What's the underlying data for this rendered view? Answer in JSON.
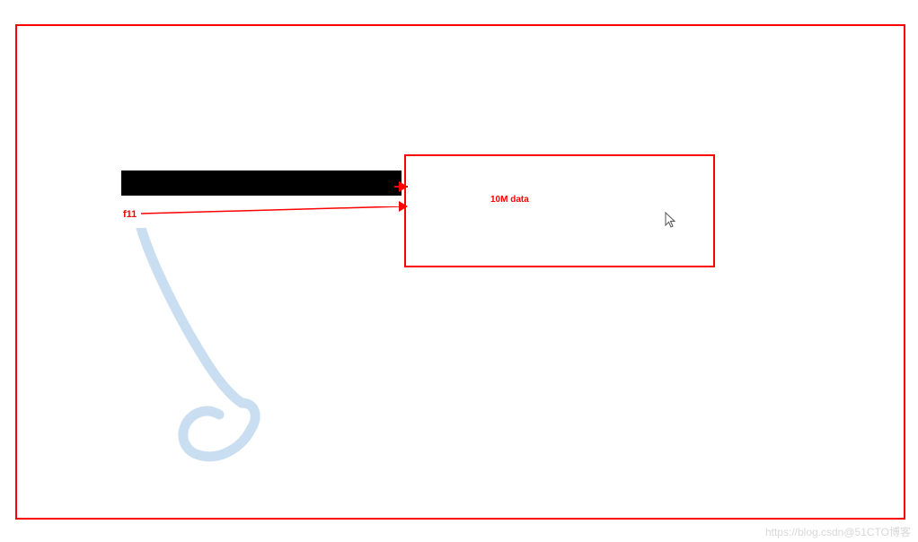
{
  "labels": {
    "f11": "f11",
    "box_content": "10M   data"
  },
  "watermark": "https://blog.csdn@51CTO博客",
  "colors": {
    "border": "#ff0000",
    "text": "#ff0000",
    "bar": "#000000",
    "scribble": "#cadef2",
    "watermark": "#d8d8d8"
  }
}
